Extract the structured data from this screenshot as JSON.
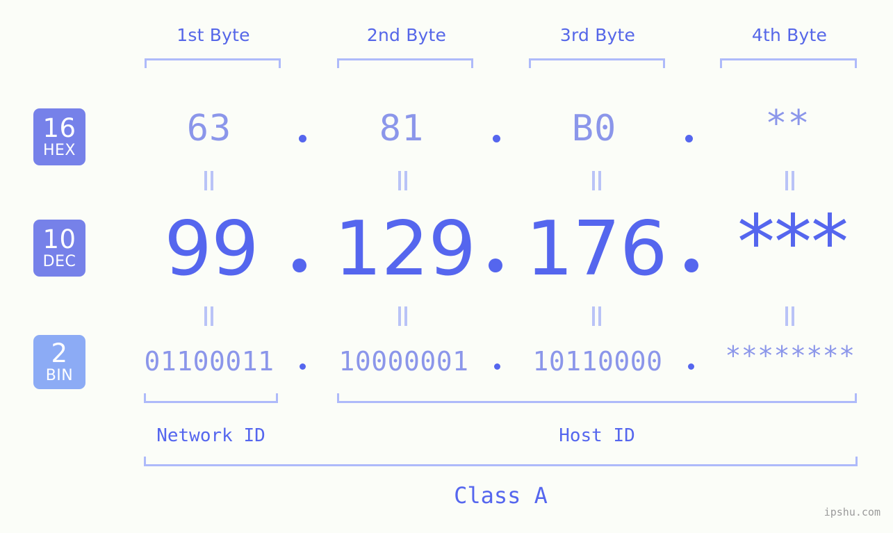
{
  "headers": {
    "bytes": [
      {
        "label": "1st Byte"
      },
      {
        "label": "2nd Byte"
      },
      {
        "label": "3rd Byte"
      },
      {
        "label": "4th Byte"
      }
    ]
  },
  "rows": {
    "hex": {
      "badge_number": "16",
      "badge_system": "HEX",
      "values": [
        "63",
        "81",
        "B0",
        "**"
      ]
    },
    "dec": {
      "badge_number": "10",
      "badge_system": "DEC",
      "values": [
        "99",
        "129",
        "176",
        "***"
      ]
    },
    "bin": {
      "badge_number": "2",
      "badge_system": "BIN",
      "values": [
        "01100011",
        "10000001",
        "10110000",
        "********"
      ]
    }
  },
  "sections": {
    "network_id": "Network ID",
    "host_id": "Host ID",
    "class": "Class A"
  },
  "watermark": "ipshu.com",
  "colors": {
    "background": "#fbfdf8",
    "badge_strong": "#7681e9",
    "badge_light": "#8cabf5",
    "value_strong": "#5566ee",
    "value_light": "#8b96ea",
    "bracket": "#aebafa",
    "header_text": "#5566e8",
    "equals": "#b9c3f7",
    "watermark_text": "#9a9a9a"
  }
}
